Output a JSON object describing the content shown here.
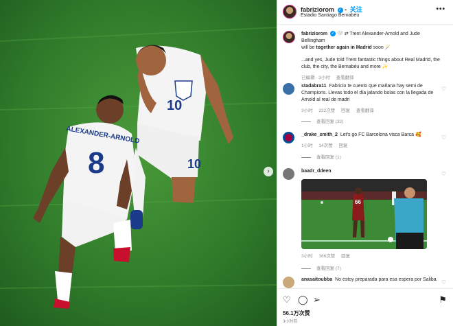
{
  "header": {
    "username": "fabriziorom",
    "follow_label": "关注",
    "location": "Estadio Santiago Bernabéu",
    "more_label": "•••"
  },
  "caption": {
    "username": "fabriziorom",
    "text_line1": "🤍 ⇄ Trent Alexander-Arnold and Jude Bellingham",
    "text_line2_pre": "will be ",
    "text_line2_bold": "together again in Madrid",
    "text_line2_post": " soon 🪄",
    "text_para": "...and yes, Jude told Trent fantastic things about Real Madrid, the club, the city, the Bernabéu and more ✨",
    "edited": "已编辑 · 3小时",
    "translate": "查看翻译"
  },
  "comments": [
    {
      "username": "stadabra11",
      "text": "Fabricio te cuento que mañana hay semi de Champions. Llevas todo el día jalando bolas con la llegada de Arnold al real de madri",
      "time": "3小时",
      "likes": "222次赞",
      "reply": "回复",
      "translate": "查看翻译",
      "view_replies": "查看回复 (32)"
    },
    {
      "username": "_drake_smith_2",
      "text": "Let's go FC Barcelona visca Barca 🥰",
      "time": "1小时",
      "likes": "14次赞",
      "reply": "回复",
      "view_replies": "查看回复 (1)"
    },
    {
      "username": "baadr_ddeen",
      "text": "",
      "time": "3小时",
      "likes": "166次赞",
      "reply": "回复",
      "view_replies": "查看回复 (7)",
      "gif_number": "66"
    },
    {
      "username": "anasaitoubba",
      "text": "No estoy preparada para esa espera por Saliba."
    }
  ],
  "photo": {
    "player_front_name": "ALEXANDER-ARNOLD",
    "player_front_number": "8",
    "player_back_number": "10",
    "player_back_shorts_number": "10"
  },
  "footer": {
    "likes": "56.1万次赞",
    "time": "3小时前",
    "icons": [
      "heart-icon",
      "comment-icon",
      "share-icon",
      "bookmark-icon"
    ]
  },
  "colors": {
    "accent": "#0095f6",
    "pitch": "#2f7a2a"
  }
}
